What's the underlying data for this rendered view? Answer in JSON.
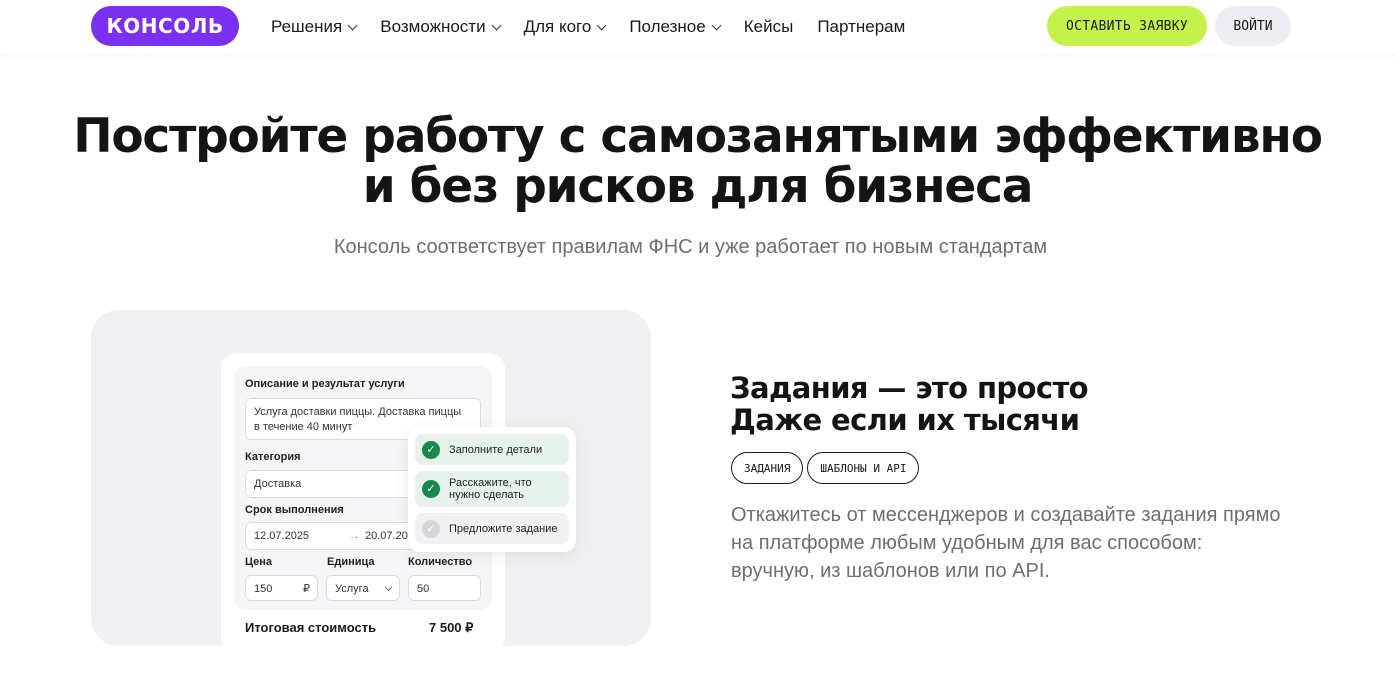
{
  "header": {
    "logo": "КОНСОЛЬ",
    "nav": [
      {
        "label": "Решения",
        "has_dropdown": true
      },
      {
        "label": "Возможности",
        "has_dropdown": true
      },
      {
        "label": "Для кого",
        "has_dropdown": true
      },
      {
        "label": "Полезное",
        "has_dropdown": true
      },
      {
        "label": "Кейсы",
        "has_dropdown": false
      },
      {
        "label": "Партнерам",
        "has_dropdown": false
      }
    ],
    "apply_button": "ОСТАВИТЬ ЗАЯВКУ",
    "login_button": "ВОЙТИ"
  },
  "hero": {
    "title_line1": "Постройте работу с самозанятыми эффективно",
    "title_line2": "и без рисков для бизнеса",
    "subtitle": "Консоль соответствует правилам ФНС и уже работает по новым стандартам"
  },
  "illustration": {
    "form": {
      "desc_label": "Описание и результат услуги",
      "desc_value_line1": "Услуга доставки пиццы. Доставка пиццы",
      "desc_value_line2": "в течение 40 минут",
      "category_label": "Категория",
      "category_value": "Доставка",
      "deadline_label": "Срок выполнения",
      "date_from": "12.07.2025",
      "date_to": "20.07.20",
      "price_label": "Цена",
      "price_value": "150",
      "currency": "₽",
      "unit_label": "Единица",
      "unit_value": "Услуга",
      "qty_label": "Количество",
      "qty_value": "50",
      "total_label": "Итоговая стоимость",
      "total_value": "7 500 ₽"
    },
    "steps": [
      {
        "line1": "Заполните детали",
        "line2": "",
        "done": true
      },
      {
        "line1": "Расскажите, что",
        "line2": "нужно сделать",
        "done": true
      },
      {
        "line1": "Предложите задание",
        "line2": "",
        "done": false
      }
    ]
  },
  "feature": {
    "title_line1": "Задания — это просто",
    "title_line2": "Даже если их тысячи",
    "tags": [
      "ЗАДАНИЯ",
      "ШАБЛОНЫ И API"
    ],
    "description": "Откажитесь от мессенджеров и создавайте задания прямо на платформе любым удобным для вас способом: вручную, из шаблонов или по API."
  },
  "colors": {
    "brand": "#7b2ff0",
    "accent": "#c5f24a",
    "success": "#17894a"
  }
}
